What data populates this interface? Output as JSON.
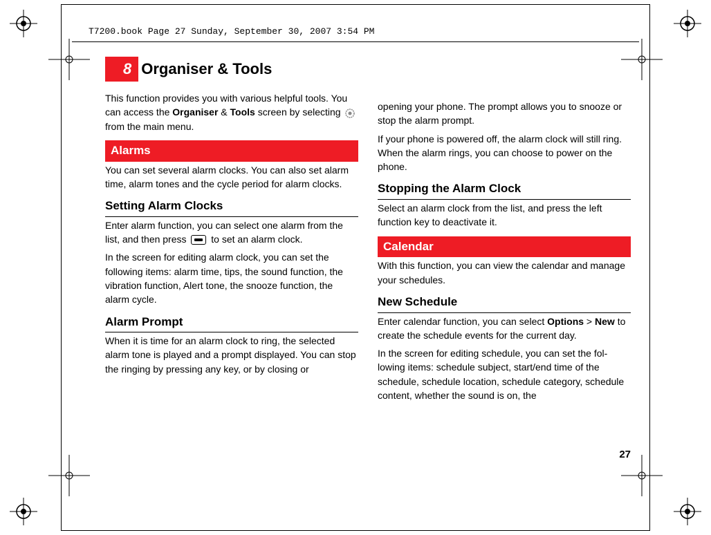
{
  "running_head": "T7200.book  Page 27  Sunday, September 30, 2007  3:54 PM",
  "chapter": {
    "number": "8",
    "title": "Organiser & Tools"
  },
  "col1": {
    "intro_a": "This function provides you with various helpful tools. You can access the ",
    "intro_b_strong1": "Organiser",
    "intro_amp": " & ",
    "intro_b_strong2": "Tools",
    "intro_c": " screen by selecting ",
    "intro_d": " from the main menu.",
    "section_alarms": " Alarms",
    "alarms_p1": "You can set several alarm clocks. You can also set alarm time, alarm tones and the cycle period for alarm clocks.",
    "sub_setting": "Setting Alarm Clocks",
    "setting_p1a": "Enter alarm function, you can select one alarm from the list, and then press ",
    "setting_p1b": " to set an alarm clock.",
    "setting_p2": "In the screen for editing alarm clock, you can set the following items: alarm time, tips, the sound function, the vibration function, Alert tone, the snooze function, the alarm cycle.",
    "sub_prompt": "Alarm Prompt",
    "prompt_p1": "When it is time for an alarm clock to ring, the selected alarm tone is played and a prompt displayed. You can stop the ringing by pressing any key, or by closing or"
  },
  "col2": {
    "cont_p1": "opening your phone. The prompt allows you to snooze or stop the alarm prompt.",
    "cont_p2": "If your phone is powered off, the alarm clock will still ring. When the alarm rings, you can choose to power on the phone.",
    "sub_stop": "Stopping the Alarm Clock",
    "stop_p1": "Select an alarm clock from the list, and press the left function key to deactivate it.",
    "section_calendar": " Calendar",
    "cal_p1": "With this function, you can view the calendar and manage your schedules.",
    "sub_newsched": "New Schedule",
    "new_p1a": "Enter calendar function, you can select ",
    "new_p1_strong1": "Options",
    "new_gt": " > ",
    "new_p1_strong2": "New",
    "new_p1b": " to create the schedule events for the current day.",
    "new_p2": "In the screen for editing schedule, you can set the fol-lowing items: schedule subject, start/end time of the schedule, schedule location, schedule category, schedule content,  whether the sound is on, the"
  },
  "page_number": "27"
}
